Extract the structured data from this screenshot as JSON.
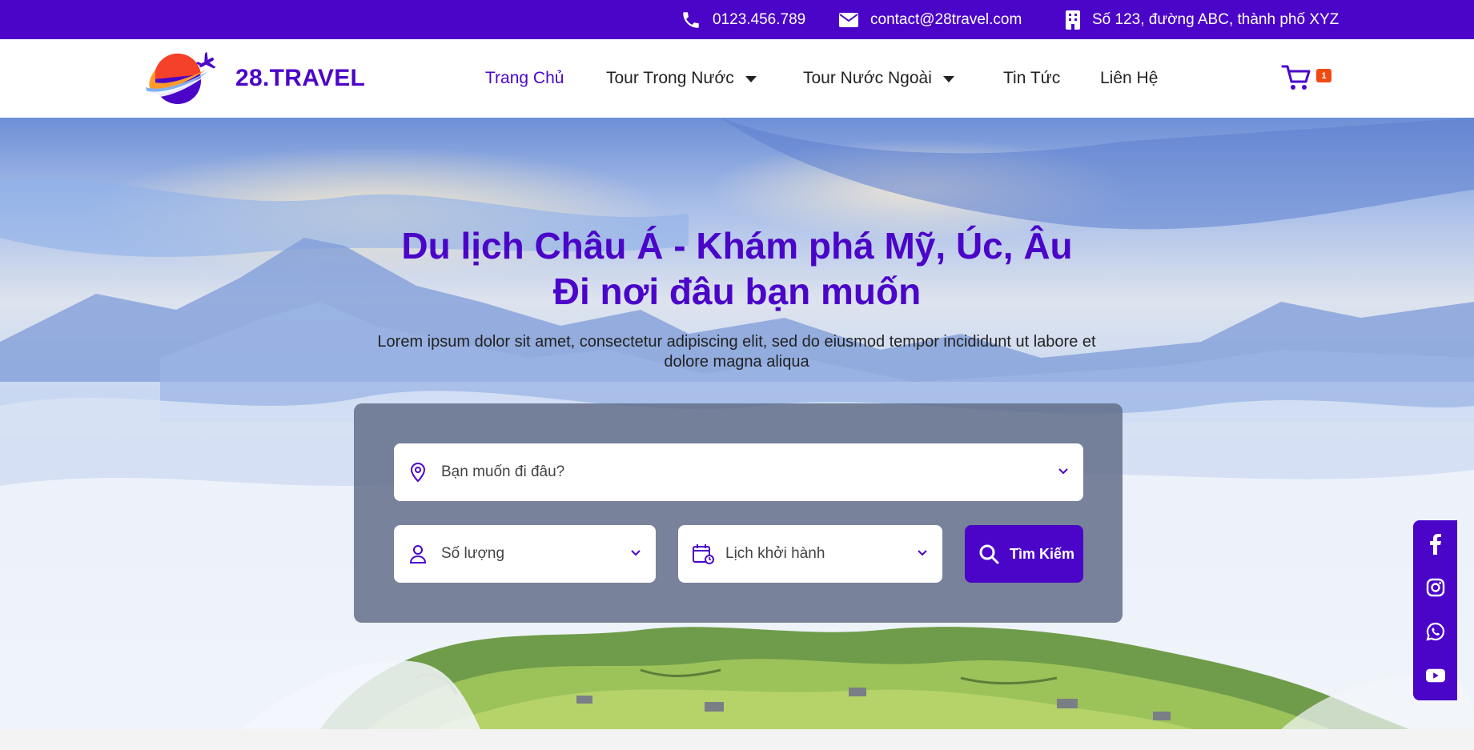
{
  "topbar": {
    "phone": "0123.456.789",
    "email": "contact@28travel.com",
    "address": "Số 123, đường ABC, thành phố XYZ"
  },
  "header": {
    "logo_text": "28.TRAVEL",
    "nav": {
      "home": "Trang Chủ",
      "domestic": "Tour Trong Nước",
      "international": "Tour Nước Ngoài",
      "news": "Tin Tức",
      "contact": "Liên Hệ"
    },
    "cart_count": "1"
  },
  "hero": {
    "title_line1": "Du lịch Châu Á - Khám phá Mỹ, Úc, Âu",
    "title_line2": "Đi nơi đâu bạn muốn",
    "subtitle": "Lorem ipsum dolor sit amet, consectetur adipiscing elit, sed do eiusmod tempor incididunt ut labore et dolore magna aliqua"
  },
  "search": {
    "destination_placeholder": "Bạn muốn đi đâu?",
    "quantity_placeholder": "Số lượng",
    "date_placeholder": "Lịch khởi hành",
    "button_label": "Tìm Kiếm"
  },
  "colors": {
    "brand": "#4b05c8",
    "badge": "#f04a14",
    "panel": "#64708a"
  },
  "icons": [
    "phone-icon",
    "mail-icon",
    "building-icon",
    "cart-icon",
    "location-pin-icon",
    "user-icon",
    "calendar-icon",
    "chevron-down-icon",
    "search-icon",
    "facebook-icon",
    "instagram-icon",
    "whatsapp-icon",
    "youtube-icon"
  ]
}
